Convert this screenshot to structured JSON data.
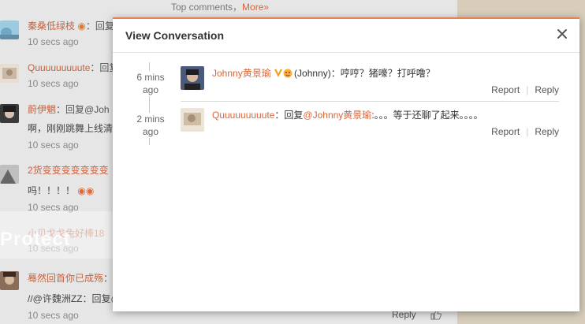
{
  "background": {
    "top_comments": {
      "label": "Top comments，",
      "more": "More»"
    },
    "items": [
      {
        "name": "秦桑低绿枝",
        "after": "：回复",
        "time": "10 secs ago"
      },
      {
        "name": "Quuuuuuuuute",
        "after": "：回复",
        "time": "10 secs ago"
      },
      {
        "name": "蔚伊魍",
        "after": "：回复@Joh",
        "line": "啊，刚刚跳舞上线清",
        "time": "10 secs ago"
      },
      {
        "name": "2货变变变变变变变",
        "line": "吗！！！！",
        "time": "10 secs ago"
      },
      {
        "name": "小贝戈戈兔好棒18",
        "time": "10 secs ago"
      },
      {
        "name": "蓦然回首你已成殇",
        "after": "：",
        "line": "//@许魏洲ZZ：回复@",
        "time": "10 secs ago"
      }
    ],
    "reply_label": "Reply",
    "watermark": "Protect"
  },
  "modal": {
    "title": "View Conversation",
    "close_icon": "close-icon",
    "accent_color": "#e8834f",
    "messages": [
      {
        "time": "6 mins ago",
        "user": "Johnny黄景瑜",
        "text": "(Johnny)：哼哼？猪嚎？打呼噜？",
        "report": "Report",
        "reply": "Reply"
      },
      {
        "time": "2 mins ago",
        "user": "Quuuuuuuuute",
        "prefix": "：回复",
        "mention": "@Johnny黄景瑜",
        "text": ":。。。等于还聊了起来。。。。",
        "report": "Report",
        "reply": "Reply"
      }
    ]
  }
}
